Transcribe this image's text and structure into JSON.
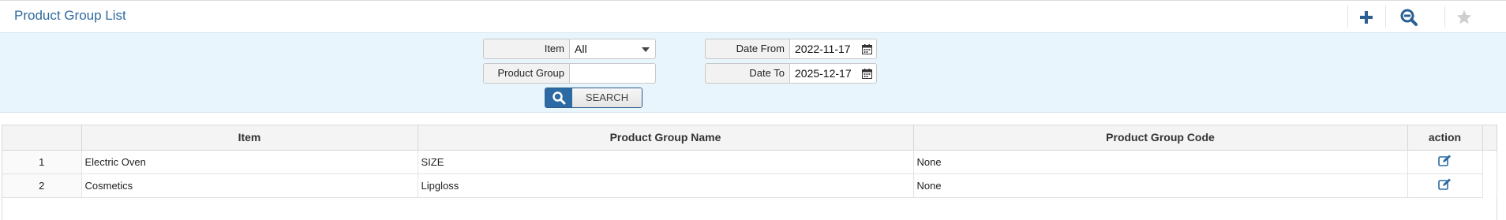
{
  "header": {
    "title": "Product Group List",
    "buttons": [
      {
        "name": "add",
        "icon": "plus-icon"
      },
      {
        "name": "zoom-out",
        "icon": "zoom-out-icon"
      },
      {
        "name": "favorite",
        "icon": "star-icon"
      }
    ]
  },
  "search": {
    "item_label": "Item",
    "item_value": "All",
    "product_group_label": "Product Group",
    "product_group_value": "",
    "date_from_label": "Date From",
    "date_from_value": "2022-11-17",
    "date_to_label": "Date To",
    "date_to_value": "2025-12-17",
    "search_button_label": "SEARCH",
    "search_icon": "search-icon",
    "calendar_icon": "calendar-icon"
  },
  "table": {
    "columns": [
      "",
      "Item",
      "Product Group Name",
      "Product Group Code",
      "action"
    ],
    "rows": [
      {
        "index": "1",
        "item": "Electric Oven",
        "name": "SIZE",
        "code": "None",
        "action_icon": "edit-icon"
      },
      {
        "index": "2",
        "item": "Cosmetics",
        "name": "Lipgloss",
        "code": "None",
        "action_icon": "edit-icon"
      }
    ]
  },
  "colors": {
    "title": "#2f6a9e",
    "accent": "#2b6aa3",
    "panel_bg": "#e9f5fc"
  }
}
